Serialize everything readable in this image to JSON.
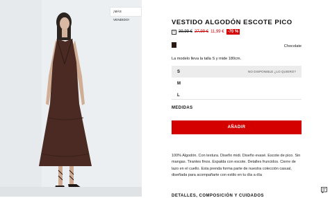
{
  "product": {
    "image_alt": "Model wearing brown halter maxi dress",
    "badge": "¡MÁS VENDIDO!",
    "title": "VESTIDO ALGODÓN ESCOTE PICO",
    "price_original": "39,99 €",
    "price_prev": "27,99 €",
    "price_current": "11,99 €",
    "discount": "-70 %",
    "color_name": "Chocolate",
    "swatch_color": "#2a1a14",
    "model_note": "La modelo lleva la talla S y mide 180cm.",
    "sizes": [
      {
        "label": "S",
        "status": "NO DISPONIBLE ¿LO QUIERO?"
      },
      {
        "label": "M",
        "status": ""
      },
      {
        "label": "L",
        "status": ""
      }
    ],
    "measures_label": "MEDIDAS",
    "add_button": "AÑADIR",
    "description": "100% Algodón. Con textura. Diseño midi. Diseño evasé. Escote de pico. Sin mangas. Tirantes finos. Espalda con escote. Detalles fruncidos. Cierre de lazo en el cuello. Esta prenda forma parte de nuestra colección casual, diseñada para acompañarte con estilo en tu día a día",
    "next_section": "DETALLES, COMPOSICIÓN Y CUIDADOS"
  },
  "colors": {
    "accent": "#d40000",
    "price_red": "#c40000"
  }
}
